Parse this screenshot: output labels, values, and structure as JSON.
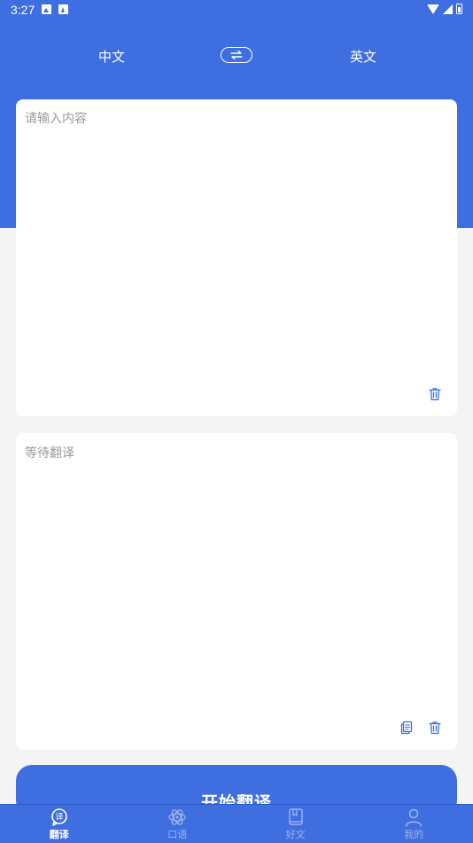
{
  "status_bar": {
    "time": "3:27",
    "left_icons": [
      "image-icon",
      "accessibility-icon"
    ],
    "right_icons": [
      "wifi-icon",
      "signal-icon",
      "battery-icon"
    ]
  },
  "language": {
    "source": "中文",
    "target": "英文",
    "swap_icon": "swap-arrows-icon"
  },
  "input_card": {
    "placeholder": "请输入内容",
    "value": "",
    "delete_icon": "trash-icon"
  },
  "output_card": {
    "text": "等待翻译",
    "copy_icon": "copy-icon",
    "delete_icon": "trash-icon"
  },
  "start_button": {
    "label": "开始翻译"
  },
  "tabs": [
    {
      "label": "翻译",
      "icon": "translate-chat-icon",
      "active": true
    },
    {
      "label": "口语",
      "icon": "atom-icon",
      "active": false
    },
    {
      "label": "好文",
      "icon": "book-icon",
      "active": false
    },
    {
      "label": "我的",
      "icon": "user-icon",
      "active": false
    }
  ],
  "colors": {
    "primary": "#3f6ee0",
    "background": "#f4f4f4",
    "card": "#ffffff",
    "placeholder": "#9a9a9a",
    "tab_inactive": "#9fb4ea"
  }
}
